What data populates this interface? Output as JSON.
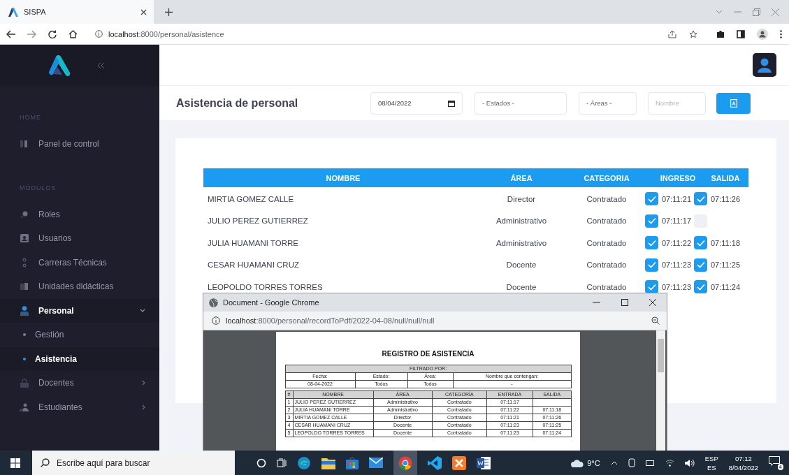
{
  "browser": {
    "tab_title": "SISPA",
    "url_host": "localhost",
    "url_path": ":8000/personal/asistence"
  },
  "sidebar": {
    "sections": [
      {
        "label": "HOME",
        "items": [
          {
            "label": "Panel de control",
            "selected": false
          }
        ]
      },
      {
        "label": "MÓDULOS",
        "items": [
          {
            "label": "Roles",
            "selected": false
          },
          {
            "label": "Usuarios",
            "selected": false
          },
          {
            "label": "Carreras Técnicas",
            "selected": false
          },
          {
            "label": "Unidades didácticas",
            "selected": false
          },
          {
            "label": "Personal",
            "selected": true,
            "expanded": true,
            "children": [
              {
                "label": "Gestión",
                "selected": false
              },
              {
                "label": "Asistencia",
                "selected": true
              }
            ]
          },
          {
            "label": "Docentes",
            "selected": false,
            "expanded": false
          },
          {
            "label": "Estudiantes",
            "selected": false,
            "expanded": false
          }
        ]
      }
    ]
  },
  "page": {
    "title": "Asistencia de personal",
    "filters": {
      "date": "08/04/2022",
      "estado": "- Estados -",
      "area": "- Áreas -",
      "nombre_placeholder": "Nombre"
    }
  },
  "table": {
    "columns": [
      "NOMBRE",
      "ÁREA",
      "CATEGORIA",
      "INGRESO",
      "SALIDA"
    ],
    "rows": [
      {
        "name": "MIRTIA GOMEZ CALLE",
        "area": "Director",
        "category": "Contratado",
        "ingreso": {
          "checked": true,
          "time": "07:11:21"
        },
        "salida": {
          "checked": true,
          "time": "07:11:26"
        }
      },
      {
        "name": "JULIO PEREZ GUTIERREZ",
        "area": "Administrativo",
        "category": "Contratado",
        "ingreso": {
          "checked": true,
          "time": "07:11:17"
        },
        "salida": {
          "checked": false
        }
      },
      {
        "name": "JULIA HUAMANI TORRE",
        "area": "Administrativo",
        "category": "Contratado",
        "ingreso": {
          "checked": true,
          "time": "07:11:22"
        },
        "salida": {
          "checked": true,
          "time": "07:11:18"
        }
      },
      {
        "name": "CESAR HUAMANI CRUZ",
        "area": "Docente",
        "category": "Contratado",
        "ingreso": {
          "checked": true,
          "time": "07:11:23"
        },
        "salida": {
          "checked": true,
          "time": "07:11:25"
        }
      },
      {
        "name": "LEOPOLDO TORRES TORRES",
        "area": "Docente",
        "category": "Contratado",
        "ingreso": {
          "checked": true,
          "time": "07:11:23"
        },
        "salida": {
          "checked": true,
          "time": "07:11:24"
        }
      }
    ]
  },
  "popup": {
    "title": "Document - Google Chrome",
    "url_host": "localhost",
    "url_path": ":8000/personal/recordToPdf/2022-04-08/null/null/null",
    "document": {
      "title": "REGISTRO DE ASISTENCIA",
      "filter_heading": "FILTRADO POR:",
      "filter_labels": [
        "Fecha:",
        "Estado:",
        "Área:",
        "Nombre que contengan:"
      ],
      "filter_values": [
        "08-04-2022",
        "Todos",
        "Todos",
        "-"
      ],
      "columns": [
        "#",
        "NOMBRE",
        "ÁREA",
        "CATEGORÍA",
        "ENTRADA",
        "SALIDA"
      ],
      "rows": [
        [
          "1",
          "JULIO PEREZ GUTIERREZ",
          "Administrativo",
          "Contratado",
          "07:11:17",
          ""
        ],
        [
          "2",
          "JULIA HUAMANI TORRE",
          "Administrativo",
          "Contratado",
          "07:11:22",
          "07:11:18"
        ],
        [
          "3",
          "MIRTIA GOMEZ CALLE",
          "Director",
          "Contratado",
          "07:11:21",
          "07:11:26"
        ],
        [
          "4",
          "CESAR HUAMANI CRUZ",
          "Docente",
          "Contratado",
          "07:11:23",
          "07:11:25"
        ],
        [
          "5",
          "LEOPOLDO TORRES TORRES",
          "Docente",
          "Contratado",
          "07:11:23",
          "07:11:24"
        ]
      ]
    }
  },
  "taskbar": {
    "search_placeholder": "Escribe aquí para buscar",
    "temperature": "9°C",
    "language": "ESP",
    "layout": "ES",
    "time": "07:12",
    "date": "8/04/2022",
    "notifications": "4"
  }
}
